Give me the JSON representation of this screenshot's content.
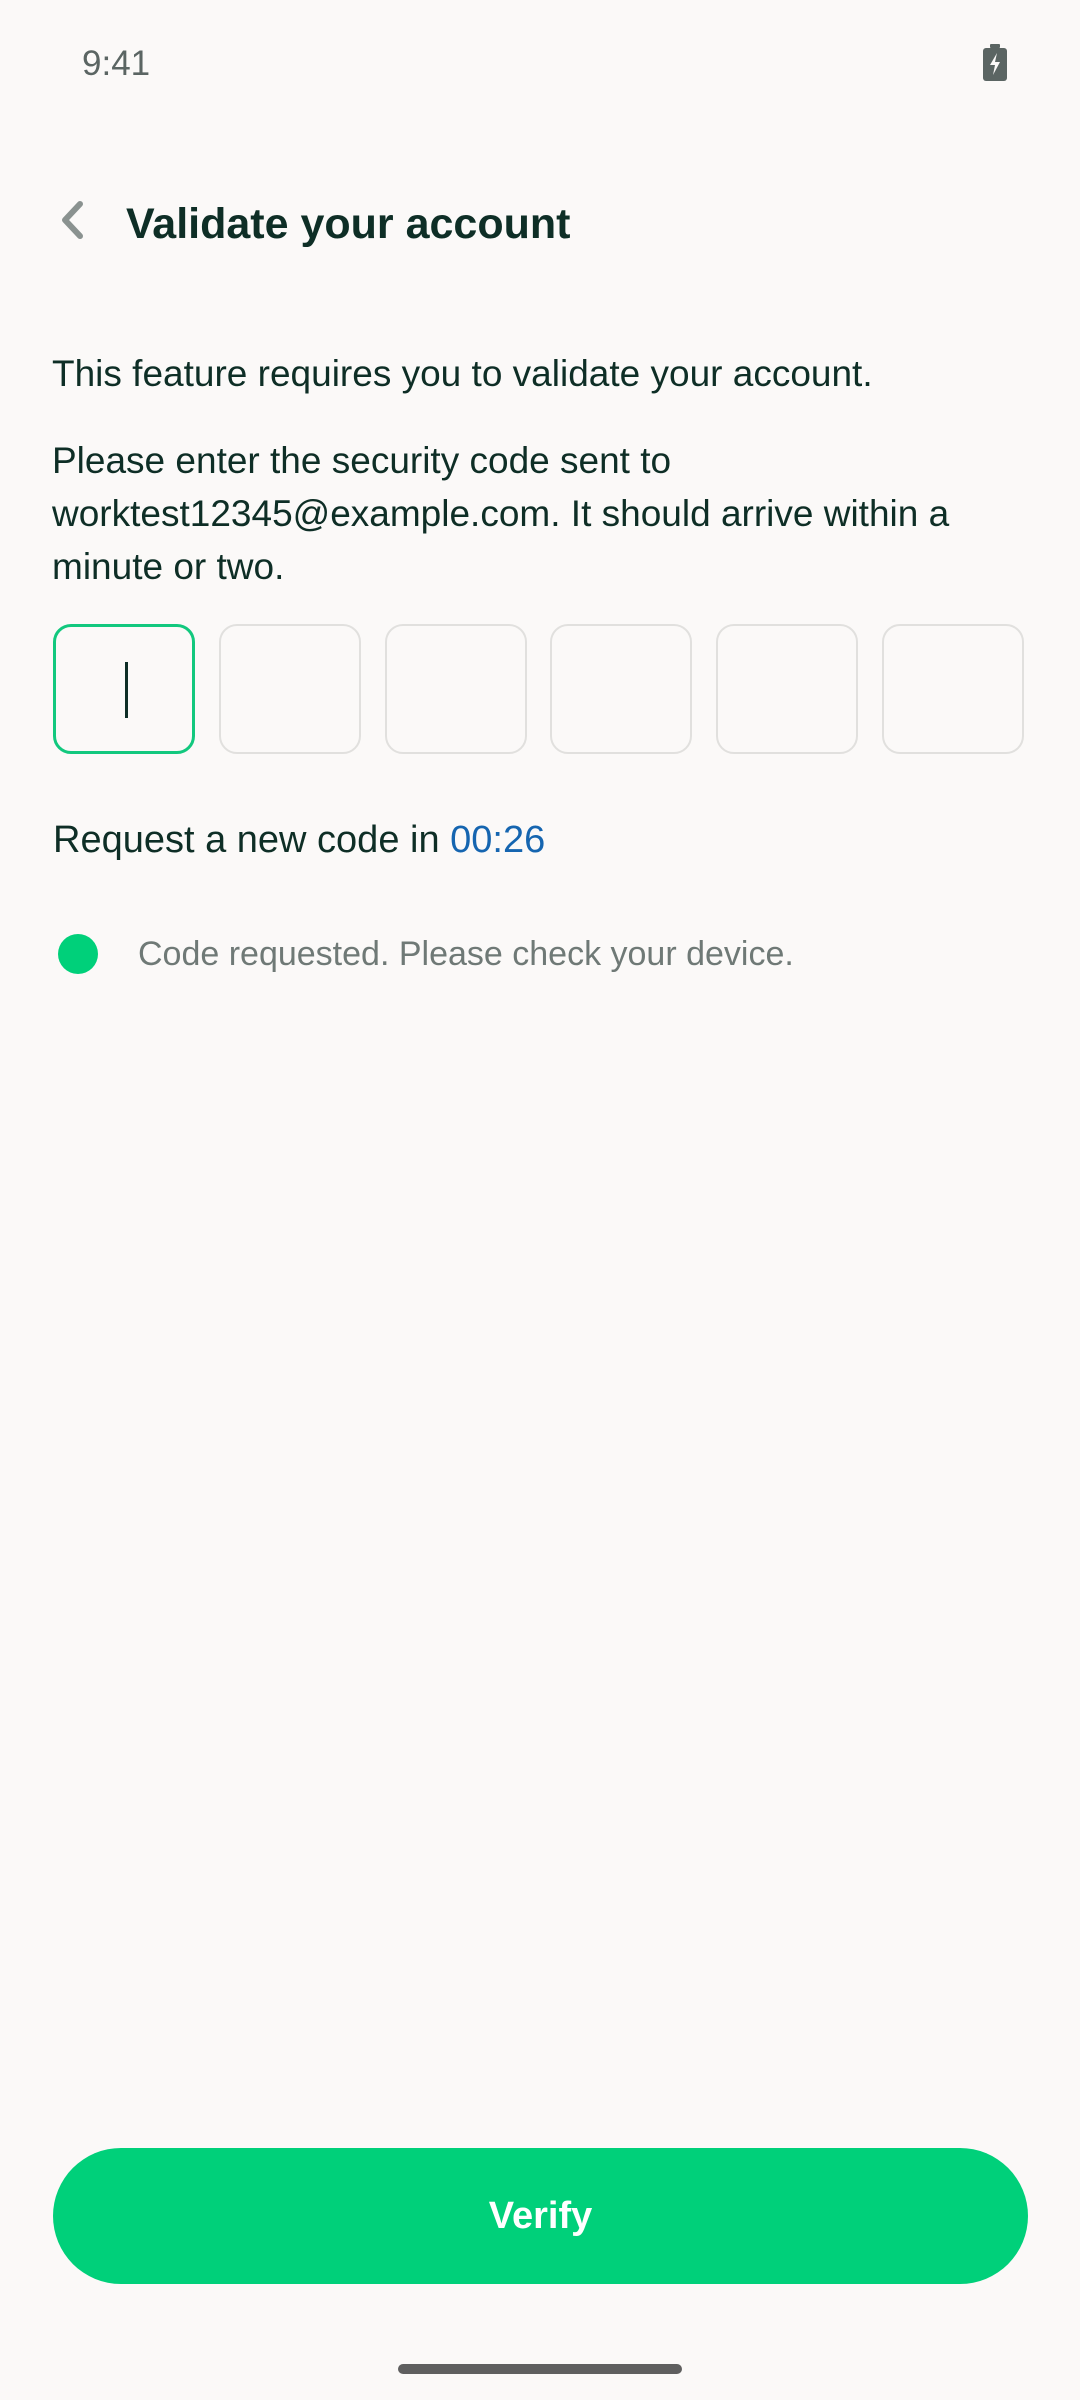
{
  "status_bar": {
    "time": "9:41",
    "battery_icon": "battery-charging-icon"
  },
  "header": {
    "back_icon": "chevron-left-icon",
    "title": "Validate your account"
  },
  "content": {
    "intro": "This feature requires you to validate your account.",
    "instruction": "Please enter the security code sent to worktest12345@example.com. It should arrive within a minute or two.",
    "code_inputs": {
      "length": 6,
      "values": [
        "",
        "",
        "",
        "",
        "",
        ""
      ],
      "active_index": 0
    },
    "resend": {
      "label": "Request a new code in ",
      "countdown": "00:26"
    },
    "notice": {
      "icon": "status-dot-icon",
      "text": "Code requested. Please check your device."
    }
  },
  "footer": {
    "verify_label": "Verify"
  },
  "colors": {
    "background": "#FBF9F8",
    "primary_text": "#0E2E26",
    "accent_green": "#00D07A",
    "focus_border": "#12C87E",
    "link_blue": "#1565B0",
    "muted_text": "#6F7976"
  }
}
